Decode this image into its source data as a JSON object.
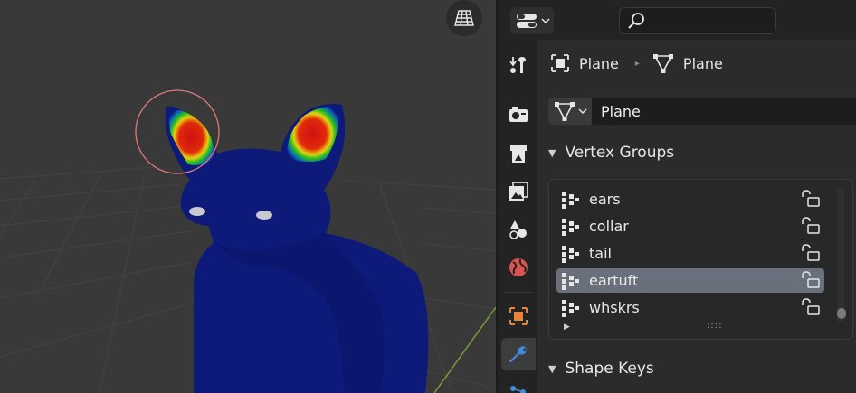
{
  "viewport": {
    "nav_icon": "grid-icon"
  },
  "header": {
    "editor_type_icon": "properties-editor-icon",
    "search_icon": "search-icon",
    "search_value": ""
  },
  "tabs": [
    {
      "name": "tool",
      "icon": "tool-icon"
    },
    {
      "name": "render",
      "icon": "render-icon"
    },
    {
      "name": "output",
      "icon": "output-icon"
    },
    {
      "name": "view-layer",
      "icon": "view-layer-icon"
    },
    {
      "name": "scene",
      "icon": "scene-icon"
    },
    {
      "name": "world",
      "icon": "world-icon"
    },
    {
      "name": "object",
      "icon": "object-icon"
    },
    {
      "name": "modifiers",
      "icon": "wrench-icon"
    },
    {
      "name": "particles",
      "icon": "particles-icon"
    }
  ],
  "breadcrumb": {
    "object_name": "Plane",
    "mesh_name": "Plane"
  },
  "datablock": {
    "name": "Plane"
  },
  "panels": {
    "vertex_groups": "Vertex Groups",
    "shape_keys": "Shape Keys"
  },
  "vertex_groups": [
    {
      "name": "ears",
      "selected": false
    },
    {
      "name": "collar",
      "selected": false
    },
    {
      "name": "tail",
      "selected": false
    },
    {
      "name": "eartuft",
      "selected": true
    },
    {
      "name": "whskrs",
      "selected": false
    }
  ],
  "list_grip": "::::",
  "colors": {
    "selected_row": "#69707b",
    "object_tab": "#e8833a",
    "modifier_tab": "#3f8de0",
    "world_tab": "#d9534f",
    "brush_circle": "#e07a7a",
    "mesh_blue": "#0d1a7a"
  }
}
